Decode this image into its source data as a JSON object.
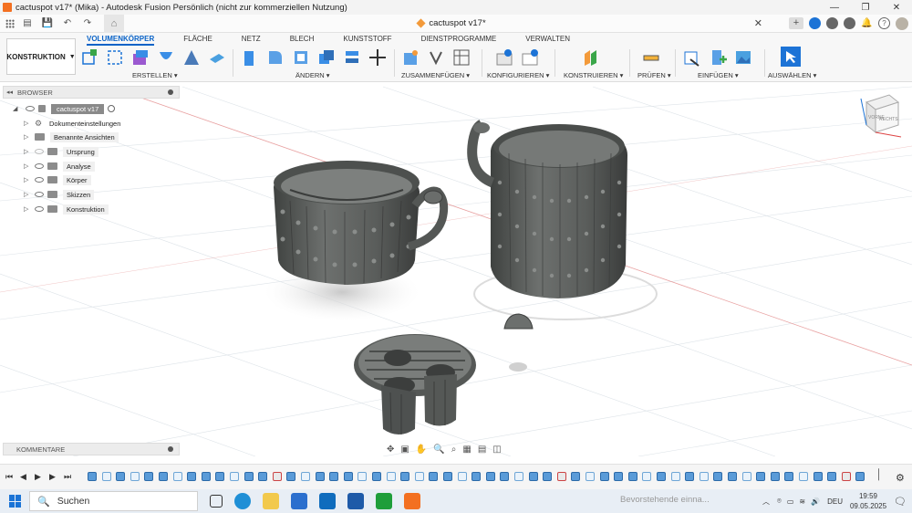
{
  "window": {
    "title": "cactuspot v17* (Mika) - Autodesk Fusion Persönlich (nicht zur kommerziellen Nutzung)",
    "controls": [
      "—",
      "❐",
      "✕"
    ]
  },
  "document_tab": {
    "name": "cactuspot v17*"
  },
  "workspace": {
    "label": "KONSTRUKTION"
  },
  "ribbon": {
    "tabs": [
      "VOLUMENKÖRPER",
      "FLÄCHE",
      "NETZ",
      "BLECH",
      "KUNSTSTOFF",
      "DIENSTPROGRAMME",
      "VERWALTEN"
    ],
    "active_tab": "VOLUMENKÖRPER",
    "groups": [
      "ERSTELLEN ▾",
      "ÄNDERN ▾",
      "ZUSAMMENFÜGEN ▾",
      "KONFIGURIEREN ▾",
      "KONSTRUIEREN ▾",
      "PRÜFEN ▾",
      "EINFÜGEN ▾",
      "AUSWÄHLEN ▾"
    ]
  },
  "browser": {
    "title": "BROWSER",
    "root": "cactuspot v17",
    "items": [
      "Dokumenteinstellungen",
      "Benannte Ansichten",
      "Ursprung",
      "Analyse",
      "Körper",
      "Skizzen",
      "Konstruktion"
    ]
  },
  "comments": {
    "title": "KOMMENTARE"
  },
  "viewcube": {
    "face_front": "VORNE",
    "face_right": "RECHTS"
  },
  "taskbar": {
    "search_placeholder": "Suchen",
    "notification": "Bevorstehende einna...",
    "language": "DEU",
    "time": "19:59",
    "date": "09.05.2025"
  },
  "colors": {
    "accent": "#0a63c7",
    "model": "#5b5e5c",
    "grid": "#d6dde4",
    "app_orange": "#f37021"
  }
}
